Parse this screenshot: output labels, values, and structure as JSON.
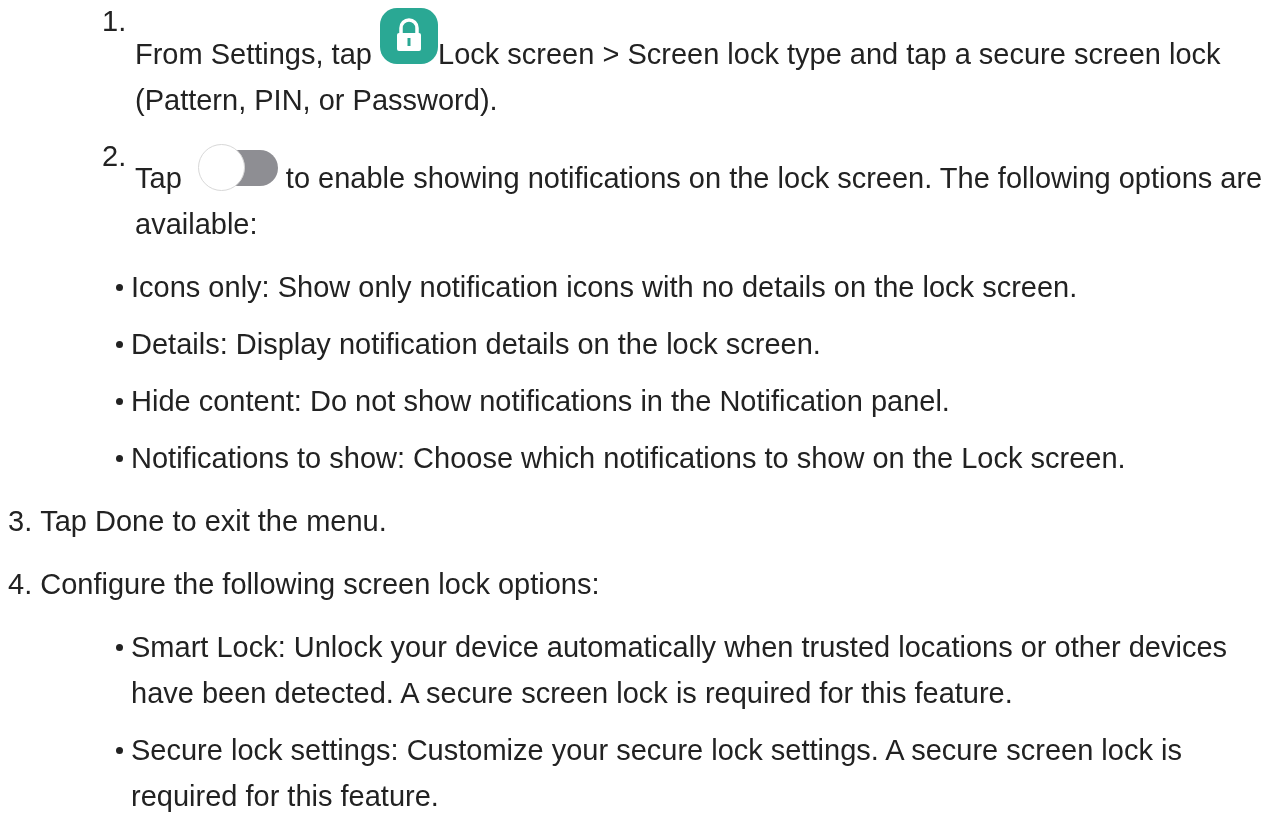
{
  "steps": [
    {
      "kind": "stacked",
      "number": "1.",
      "before": "From Settings, tap",
      "control": {
        "kind": "app_icon"
      },
      "after_lines": [
        "Lock screen > Screen lock type and tap a secure screen lock",
        "(Pattern, PIN, or Password)."
      ]
    },
    {
      "kind": "stacked",
      "number": "2.",
      "before": "Tap",
      "control": {
        "kind": "toggle",
        "on": false
      },
      "after_lines": [
        "to enable showing notifications on the lock screen. The following options are",
        "available:"
      ],
      "bullets": [
        "Icons only: Show only notification icons with no details on the lock screen.",
        "Details: Display notification details on the lock screen.",
        "Hide content: Do not show notifications in the Notification panel.",
        "Notifications to show: Choose which notifications to show on the Lock screen."
      ]
    },
    {
      "kind": "inline",
      "number": "3.",
      "text": "Tap Done to exit the menu."
    },
    {
      "kind": "inline",
      "number": "4.",
      "text": "Configure the following screen lock options:",
      "bullets": [
        "Smart Lock: Unlock your device automatically when trusted locations or other devices have been detected. A secure screen lock is required for this feature.",
        "Secure lock settings: Customize your secure lock settings. A secure screen lock is required for this feature."
      ]
    }
  ]
}
